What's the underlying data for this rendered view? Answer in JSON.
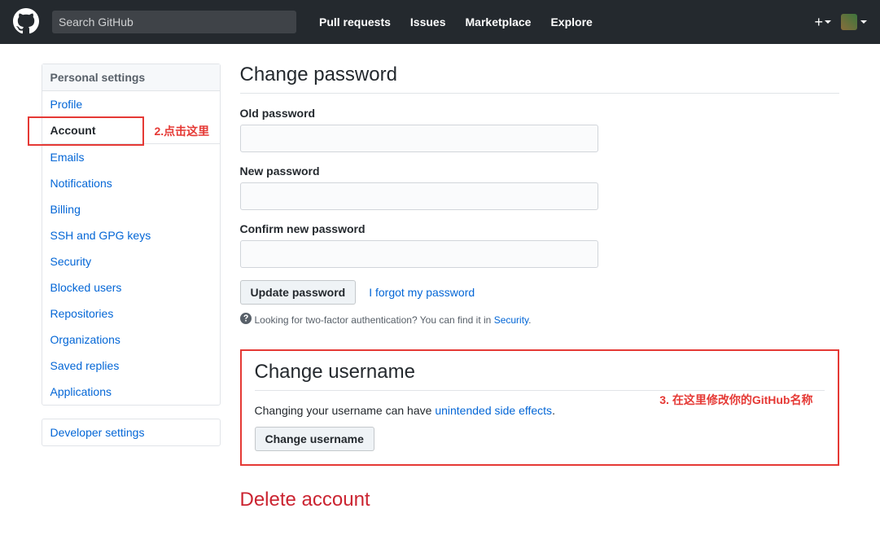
{
  "header": {
    "search_placeholder": "Search GitHub",
    "nav": [
      "Pull requests",
      "Issues",
      "Marketplace",
      "Explore"
    ]
  },
  "sidebar": {
    "header": "Personal settings",
    "items": [
      {
        "label": "Profile",
        "active": false
      },
      {
        "label": "Account",
        "active": true
      },
      {
        "label": "Emails",
        "active": false
      },
      {
        "label": "Notifications",
        "active": false
      },
      {
        "label": "Billing",
        "active": false
      },
      {
        "label": "SSH and GPG keys",
        "active": false
      },
      {
        "label": "Security",
        "active": false
      },
      {
        "label": "Blocked users",
        "active": false
      },
      {
        "label": "Repositories",
        "active": false
      },
      {
        "label": "Organizations",
        "active": false
      },
      {
        "label": "Saved replies",
        "active": false
      },
      {
        "label": "Applications",
        "active": false
      }
    ],
    "developer_label": "Developer settings"
  },
  "annotations": {
    "step2": "2.点击这里",
    "step3": "3. 在这里修改你的GitHub名称"
  },
  "password": {
    "title": "Change password",
    "old_label": "Old password",
    "new_label": "New password",
    "confirm_label": "Confirm new password",
    "update_btn": "Update password",
    "forgot_link": "I forgot my password",
    "tfa_prefix": "Looking for two-factor authentication? You can find it in ",
    "tfa_link": "Security",
    "tfa_suffix": "."
  },
  "username": {
    "title": "Change username",
    "desc_prefix": "Changing your username can have ",
    "desc_link": "unintended side effects",
    "desc_suffix": ".",
    "btn": "Change username"
  },
  "delete": {
    "title": "Delete account"
  }
}
